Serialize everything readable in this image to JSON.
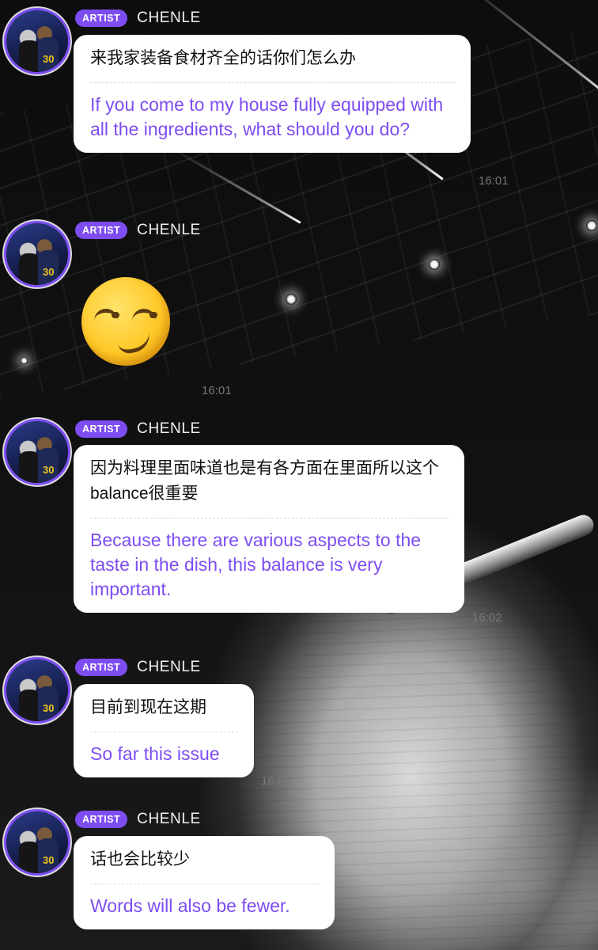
{
  "sender": {
    "badge": "ARTIST",
    "name": "CHENLE"
  },
  "messages": [
    {
      "kind": "text",
      "original": "来我家装备食材齐全的话你们怎么办",
      "translation": "If you come to my house fully equipped with all the ingredients, what should you do?",
      "time": "16:01"
    },
    {
      "kind": "emoji",
      "emoji_name": "smirking-face",
      "time": "16:01"
    },
    {
      "kind": "text",
      "original": "因为料理里面味道也是有各方面在里面所以这个balance很重要",
      "translation": "Because there are various aspects to the taste in the dish, this balance is very important.",
      "time": "16:02"
    },
    {
      "kind": "text",
      "original": "目前到现在这期",
      "translation": "So far this issue",
      "time": "16:03"
    },
    {
      "kind": "text",
      "original": "话也会比较少",
      "translation": "Words will also be fewer.",
      "time": ""
    }
  ],
  "colors": {
    "accent": "#7d4df2",
    "bubble": "#ffffff",
    "timestamp": "#777777"
  }
}
